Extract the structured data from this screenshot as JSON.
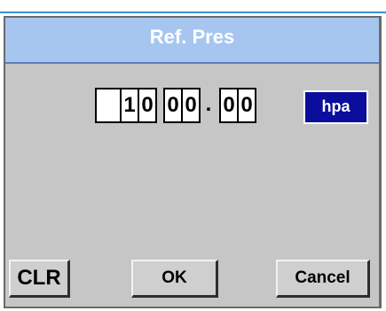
{
  "dialog": {
    "title": "Ref. Pres"
  },
  "entry": {
    "digits": [
      "",
      "1",
      "0",
      "0",
      "0",
      ".",
      "0",
      "0"
    ],
    "unit": "hpa"
  },
  "buttons": {
    "clr_label": "CLR",
    "ok_label": "OK",
    "cancel_label": "Cancel"
  },
  "colors": {
    "title_bar": "#a7c6ef",
    "screen_bg": "#c6c6c6",
    "unit_bg": "#0b0d9c",
    "top_accent": "#3b8fd6"
  }
}
